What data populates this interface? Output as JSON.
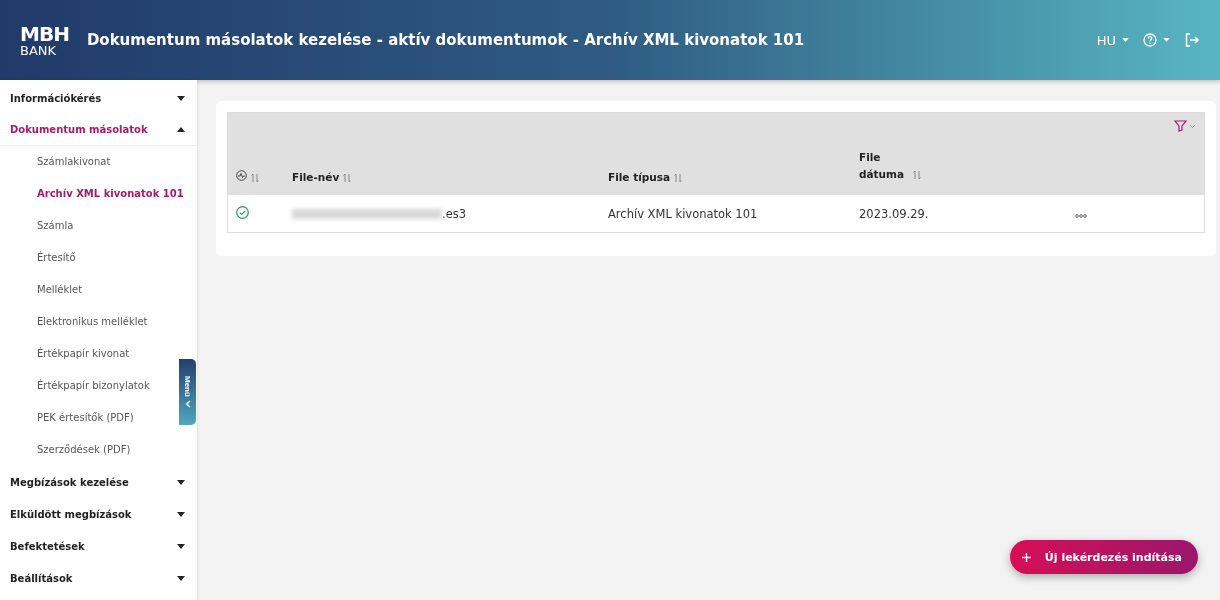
{
  "header": {
    "logo_top": "MBH",
    "logo_bottom": "BANK",
    "title": "Dokumentum másolatok kezelése - aktív dokumentumok - Archív XML kivonatok 101",
    "language": "HU"
  },
  "sidebar": {
    "items": [
      {
        "label": "Információkérés",
        "expanded": false,
        "selected": false
      },
      {
        "label": "Dokumentum másolatok",
        "expanded": true,
        "selected": true,
        "children": [
          {
            "label": "Számlakivonat",
            "selected": false
          },
          {
            "label": "Archív XML kivonatok 101",
            "selected": true
          },
          {
            "label": "Számla",
            "selected": false
          },
          {
            "label": "Értesítő",
            "selected": false
          },
          {
            "label": "Melléklet",
            "selected": false
          },
          {
            "label": "Elektronikus melléklet",
            "selected": false
          },
          {
            "label": "Értékpapír kivonat",
            "selected": false
          },
          {
            "label": "Értékpapír bizonylatok",
            "selected": false
          },
          {
            "label": "PEK értesítők (PDF)",
            "selected": false
          },
          {
            "label": "Szerződések (PDF)",
            "selected": false
          }
        ]
      },
      {
        "label": "Megbízások kezelése",
        "expanded": false,
        "selected": false
      },
      {
        "label": "Elküldött megbízások",
        "expanded": false,
        "selected": false
      },
      {
        "label": "Befektetések",
        "expanded": false,
        "selected": false
      },
      {
        "label": "Beállítások",
        "expanded": false,
        "selected": false
      }
    ]
  },
  "menu_toggle": {
    "label": "Menü"
  },
  "table": {
    "columns": [
      {
        "kind": "status"
      },
      {
        "label": "File-név",
        "kind": "text"
      },
      {
        "label": "File típusa",
        "kind": "text"
      },
      {
        "label": "File dátuma",
        "kind": "text"
      },
      {
        "kind": "actions"
      }
    ],
    "rows": [
      {
        "completed": true,
        "file_name": ".es3",
        "file_type": "Archív XML kivonatok 101",
        "file_date": "2023.09.29."
      }
    ]
  },
  "fab": {
    "label": "Új lekérdezés indítása"
  }
}
